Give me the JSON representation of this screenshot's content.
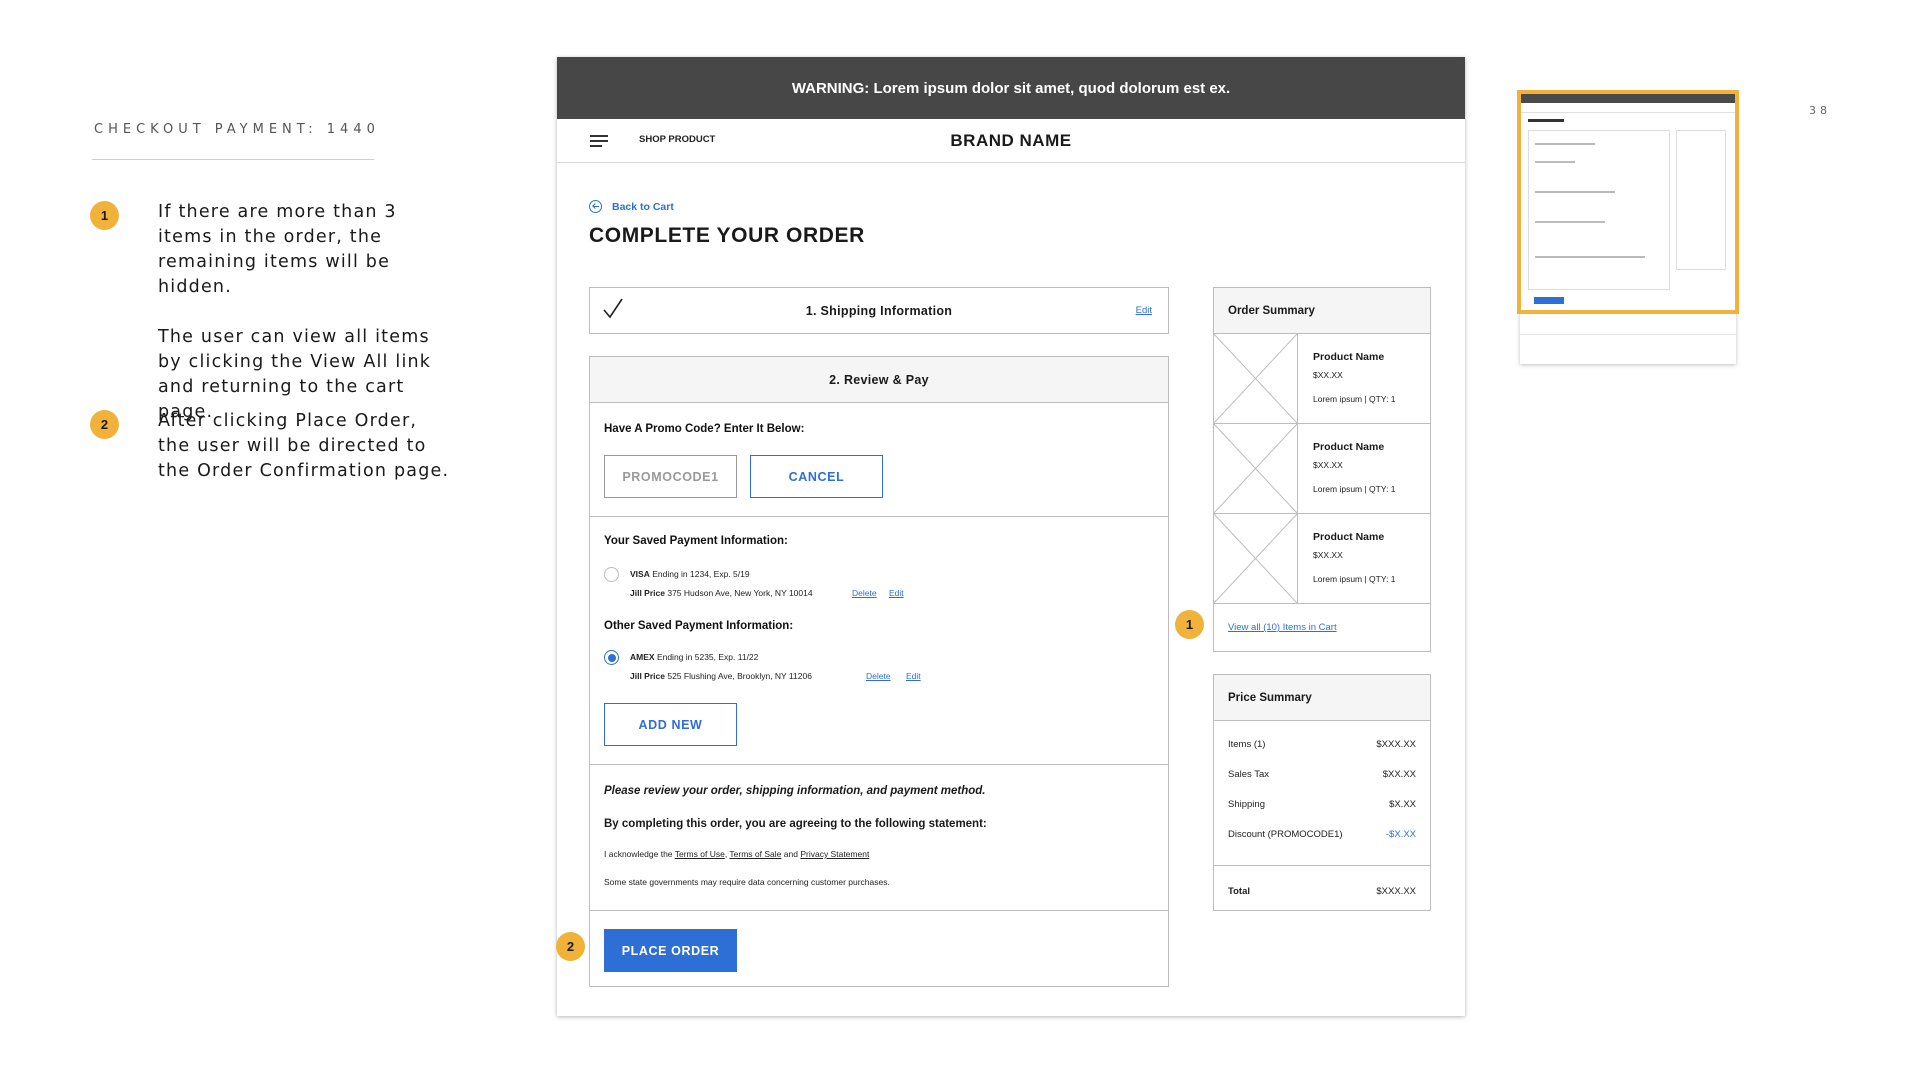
{
  "slide": {
    "label": "CHECKOUT PAYMENT: 1440",
    "page_number": "38",
    "notes": [
      {
        "number": "1",
        "paragraphs": [
          "If there are more than 3 items in the order, the remaining items will be hidden.",
          "The user can view all items by clicking the View All link and returning to the cart page."
        ]
      },
      {
        "number": "2",
        "paragraphs": [
          "After clicking Place Order, the user will be directed to the Order Confirmation page."
        ]
      }
    ]
  },
  "warning": "WARNING: Lorem ipsum dolor sit amet, quod dolorum est ex.",
  "header": {
    "menu_icon": "hamburger-icon",
    "shop_link": "SHOP PRODUCT",
    "brand": "BRAND NAME"
  },
  "page": {
    "back_link": "Back to Cart",
    "back_icon": "arrow-left-circle-icon",
    "title": "COMPLETE YOUR ORDER"
  },
  "shipping": {
    "icon": "checkmark-icon",
    "title": "1. Shipping Information",
    "edit": "Edit"
  },
  "review": {
    "title": "2. Review & Pay",
    "promo": {
      "label": "Have A Promo Code? Enter It Below:",
      "value": "PROMOCODE1",
      "cancel": "CANCEL"
    },
    "saved": {
      "label": "Your Saved Payment Information:",
      "card": {
        "brand": "VISA",
        "detail": "Ending in 1234, Exp. 5/19",
        "name": "Jill Price",
        "address": "375 Hudson Ave, New York, NY 10014",
        "selected": false
      },
      "delete": "Delete",
      "edit": "Edit"
    },
    "other": {
      "label": "Other Saved Payment Information:",
      "card": {
        "brand": "AMEX",
        "detail": "Ending in 5235, Exp. 11/22",
        "name": "Jill Price",
        "address": "525 Flushing Ave, Brooklyn, NY 11206",
        "selected": true
      },
      "delete": "Delete",
      "edit": "Edit"
    },
    "add_new": "ADD NEW",
    "terms": {
      "review_note": "Please review your order, shipping information, and payment method.",
      "agree": "By completing this order, you are agreeing to the following statement:",
      "ack_prefix": "I acknowledge the",
      "terms_of_use": "Terms of Use",
      "comma": ",",
      "terms_of_sale": "Terms of Sale",
      "and": "and",
      "privacy": "Privacy Statement",
      "disclaimer": "Some state governments may require data concerning customer purchases."
    },
    "place_order": "PLACE ORDER"
  },
  "order_summary": {
    "title": "Order Summary",
    "products": [
      {
        "name": "Product Name",
        "price": "$XX.XX",
        "meta": "Lorem ipsum | QTY: 1"
      },
      {
        "name": "Product Name",
        "price": "$XX.XX",
        "meta": "Lorem ipsum | QTY: 1"
      },
      {
        "name": "Product Name",
        "price": "$XX.XX",
        "meta": "Lorem ipsum | QTY: 1"
      }
    ],
    "view_all": "View all (10) Items in Cart"
  },
  "price_summary": {
    "title": "Price Summary",
    "rows": [
      {
        "label": "Items (1)",
        "value": "$XXX.XX"
      },
      {
        "label": "Sales Tax",
        "value": "$XX.XX"
      },
      {
        "label": "Shipping",
        "value": "$X.XX"
      },
      {
        "label": "Discount (PROMOCODE1)",
        "value": "-$X.XX"
      }
    ],
    "total_label": "Total",
    "total_value": "$XXX.XX"
  },
  "annotations": {
    "view_all_badge": "1",
    "place_order_badge": "2"
  },
  "colors": {
    "accent": "#2e6fd6",
    "badge": "#f0b23a",
    "warning_bar": "#474747"
  }
}
